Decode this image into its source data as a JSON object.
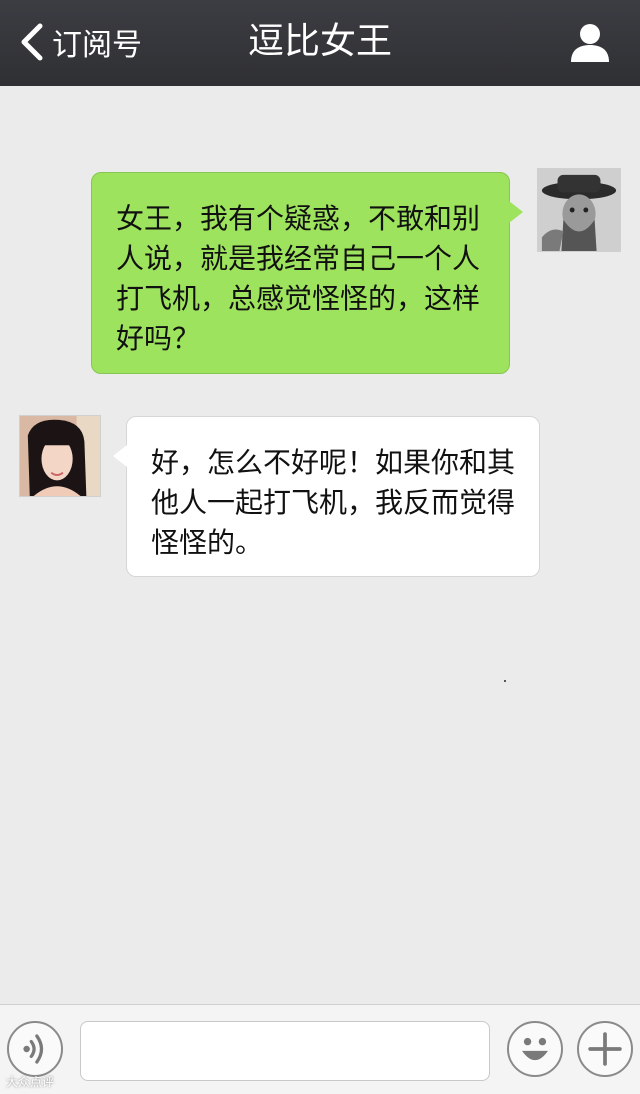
{
  "header": {
    "back_label": "订阅号",
    "title": "逗比女王",
    "back_icon": "chevron-left-icon",
    "profile_icon": "user-icon"
  },
  "messages": [
    {
      "side": "sent",
      "text": "女王，我有个疑惑，不敢和别人说，就是我经常自己一个人打飞机，总感觉怪怪的，这样好吗？"
    },
    {
      "side": "received",
      "text": "好，怎么不好呢！如果你和其他人一起打飞机，我反而觉得怪怪的。"
    }
  ],
  "input_bar": {
    "voice_icon": "voice-icon",
    "emoji_icon": "emoji-icon",
    "plus_icon": "plus-icon",
    "text_value": ""
  },
  "watermark": "大众点评",
  "colors": {
    "header_bg": "#333438",
    "sent_bubble": "#9ee35d",
    "received_bubble": "#ffffff",
    "chat_bg": "#ebebeb"
  }
}
